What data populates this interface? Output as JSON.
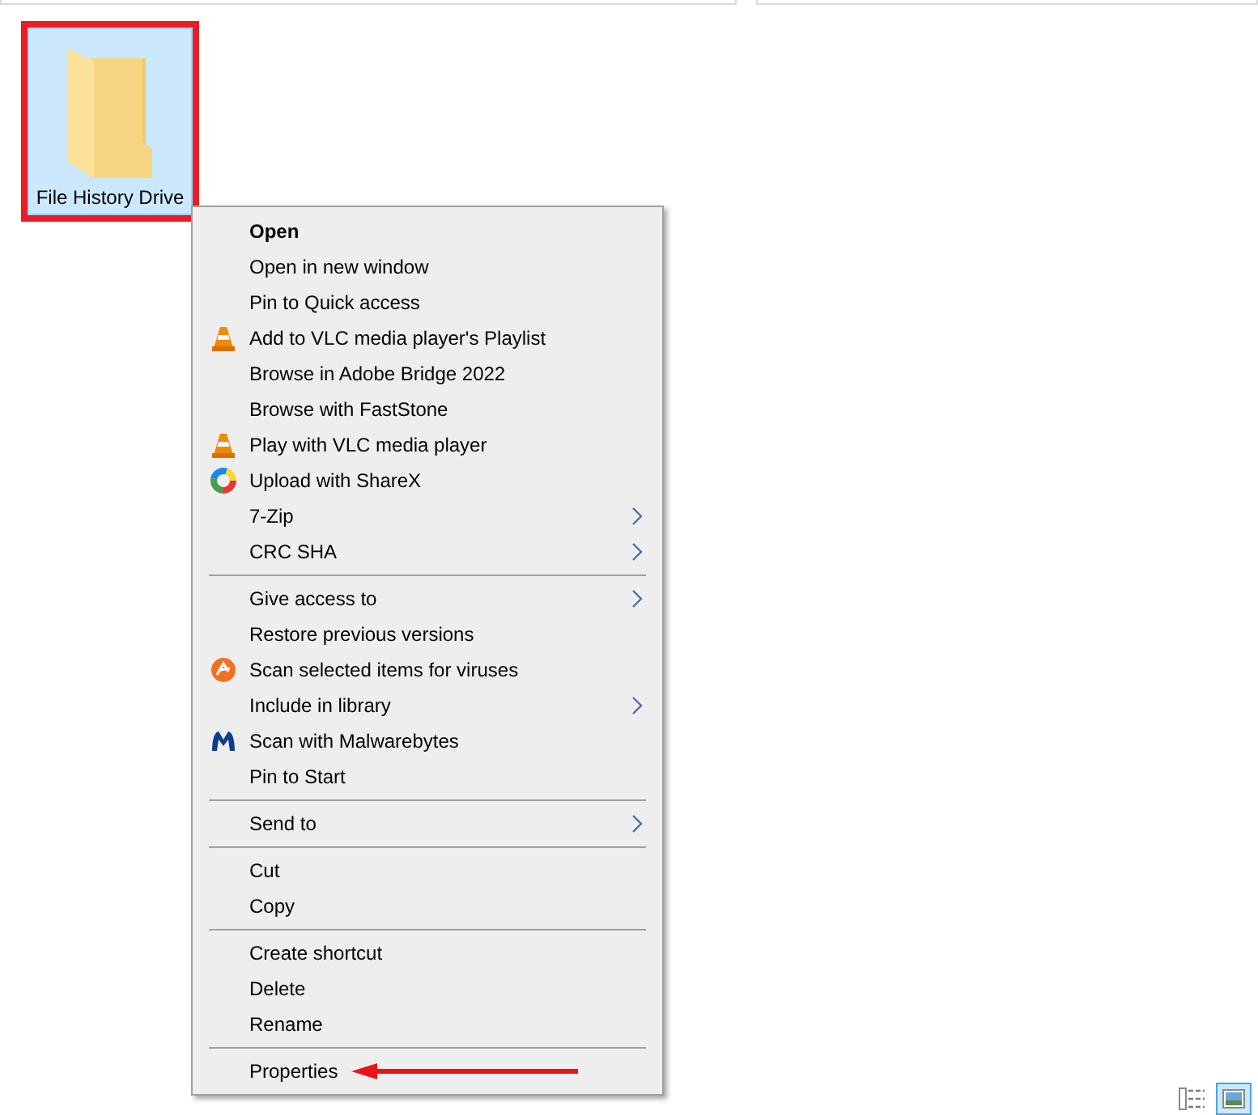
{
  "folder": {
    "label": "File History Drive",
    "selected": true,
    "highlighted": true
  },
  "context_menu": {
    "items": [
      {
        "kind": "default",
        "label": "Open"
      },
      {
        "kind": "item",
        "label": "Open in new window"
      },
      {
        "kind": "item",
        "label": "Pin to Quick access"
      },
      {
        "kind": "cone",
        "label": "Add to VLC media player's Playlist"
      },
      {
        "kind": "item",
        "label": "Browse in Adobe Bridge 2022"
      },
      {
        "kind": "item",
        "label": "Browse with FastStone"
      },
      {
        "kind": "cone",
        "label": "Play with VLC media player"
      },
      {
        "kind": "ring",
        "label": "Upload with ShareX"
      },
      {
        "kind": "submenu",
        "label": "7-Zip"
      },
      {
        "kind": "submenu",
        "label": "CRC SHA"
      },
      {
        "kind": "separator"
      },
      {
        "kind": "submenu",
        "label": "Give access to"
      },
      {
        "kind": "item",
        "label": "Restore previous versions"
      },
      {
        "kind": "badge",
        "label": "Scan selected items for viruses"
      },
      {
        "kind": "submenu",
        "label": "Include in library"
      },
      {
        "kind": "mlogo",
        "label": "Scan with Malwarebytes"
      },
      {
        "kind": "item",
        "label": "Pin to Start"
      },
      {
        "kind": "separator"
      },
      {
        "kind": "submenu",
        "label": "Send to"
      },
      {
        "kind": "separator"
      },
      {
        "kind": "item",
        "label": "Cut"
      },
      {
        "kind": "item",
        "label": "Copy"
      },
      {
        "kind": "separator"
      },
      {
        "kind": "item",
        "label": "Create shortcut"
      },
      {
        "kind": "item",
        "label": "Delete"
      },
      {
        "kind": "item",
        "label": "Rename"
      },
      {
        "kind": "separator"
      },
      {
        "kind": "item",
        "label": "Properties",
        "pointed_at": true
      }
    ]
  },
  "view_buttons": [
    {
      "kind": "details",
      "selected": false
    },
    {
      "kind": "large-icons",
      "selected": true
    }
  ]
}
